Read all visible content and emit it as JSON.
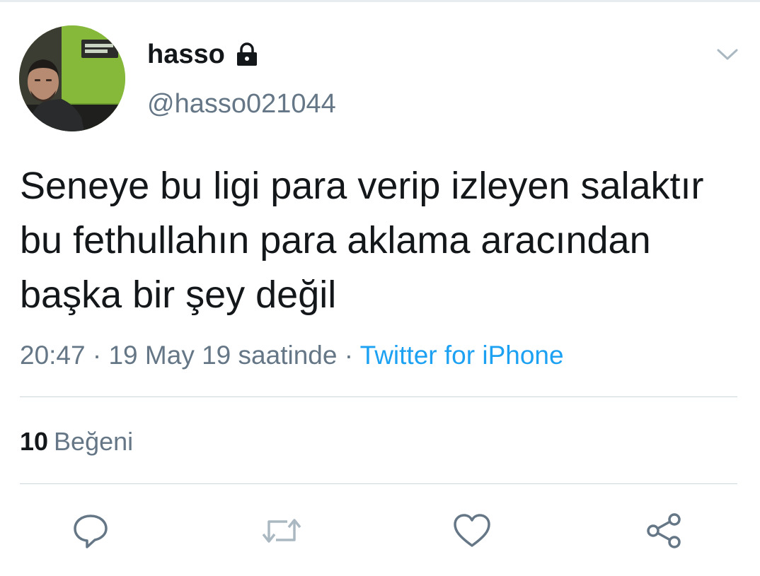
{
  "user": {
    "display_name": "hasso",
    "handle": "@hasso021044",
    "avatar_icon": "profile-photo",
    "protected_icon": "lock-icon"
  },
  "tweet": {
    "text": "Seneye bu ligi para verip izleyen salaktır bu fethullahın para aklama aracından başka bir şey değil",
    "time": "20:47",
    "date": "19 May 19 saatinde",
    "separator": "·",
    "source": "Twitter for iPhone"
  },
  "stats": {
    "likes_count": "10",
    "likes_label": "Beğeni"
  },
  "actions": {
    "icons": [
      "reply-icon",
      "retweet-icon",
      "like-icon",
      "share-icon"
    ]
  },
  "colors": {
    "text": "#14171a",
    "secondary": "#657786",
    "link": "#1da1f2",
    "divider": "#ccd6dd",
    "icon": "#657786",
    "retweet_disabled": "#aab8c2"
  }
}
